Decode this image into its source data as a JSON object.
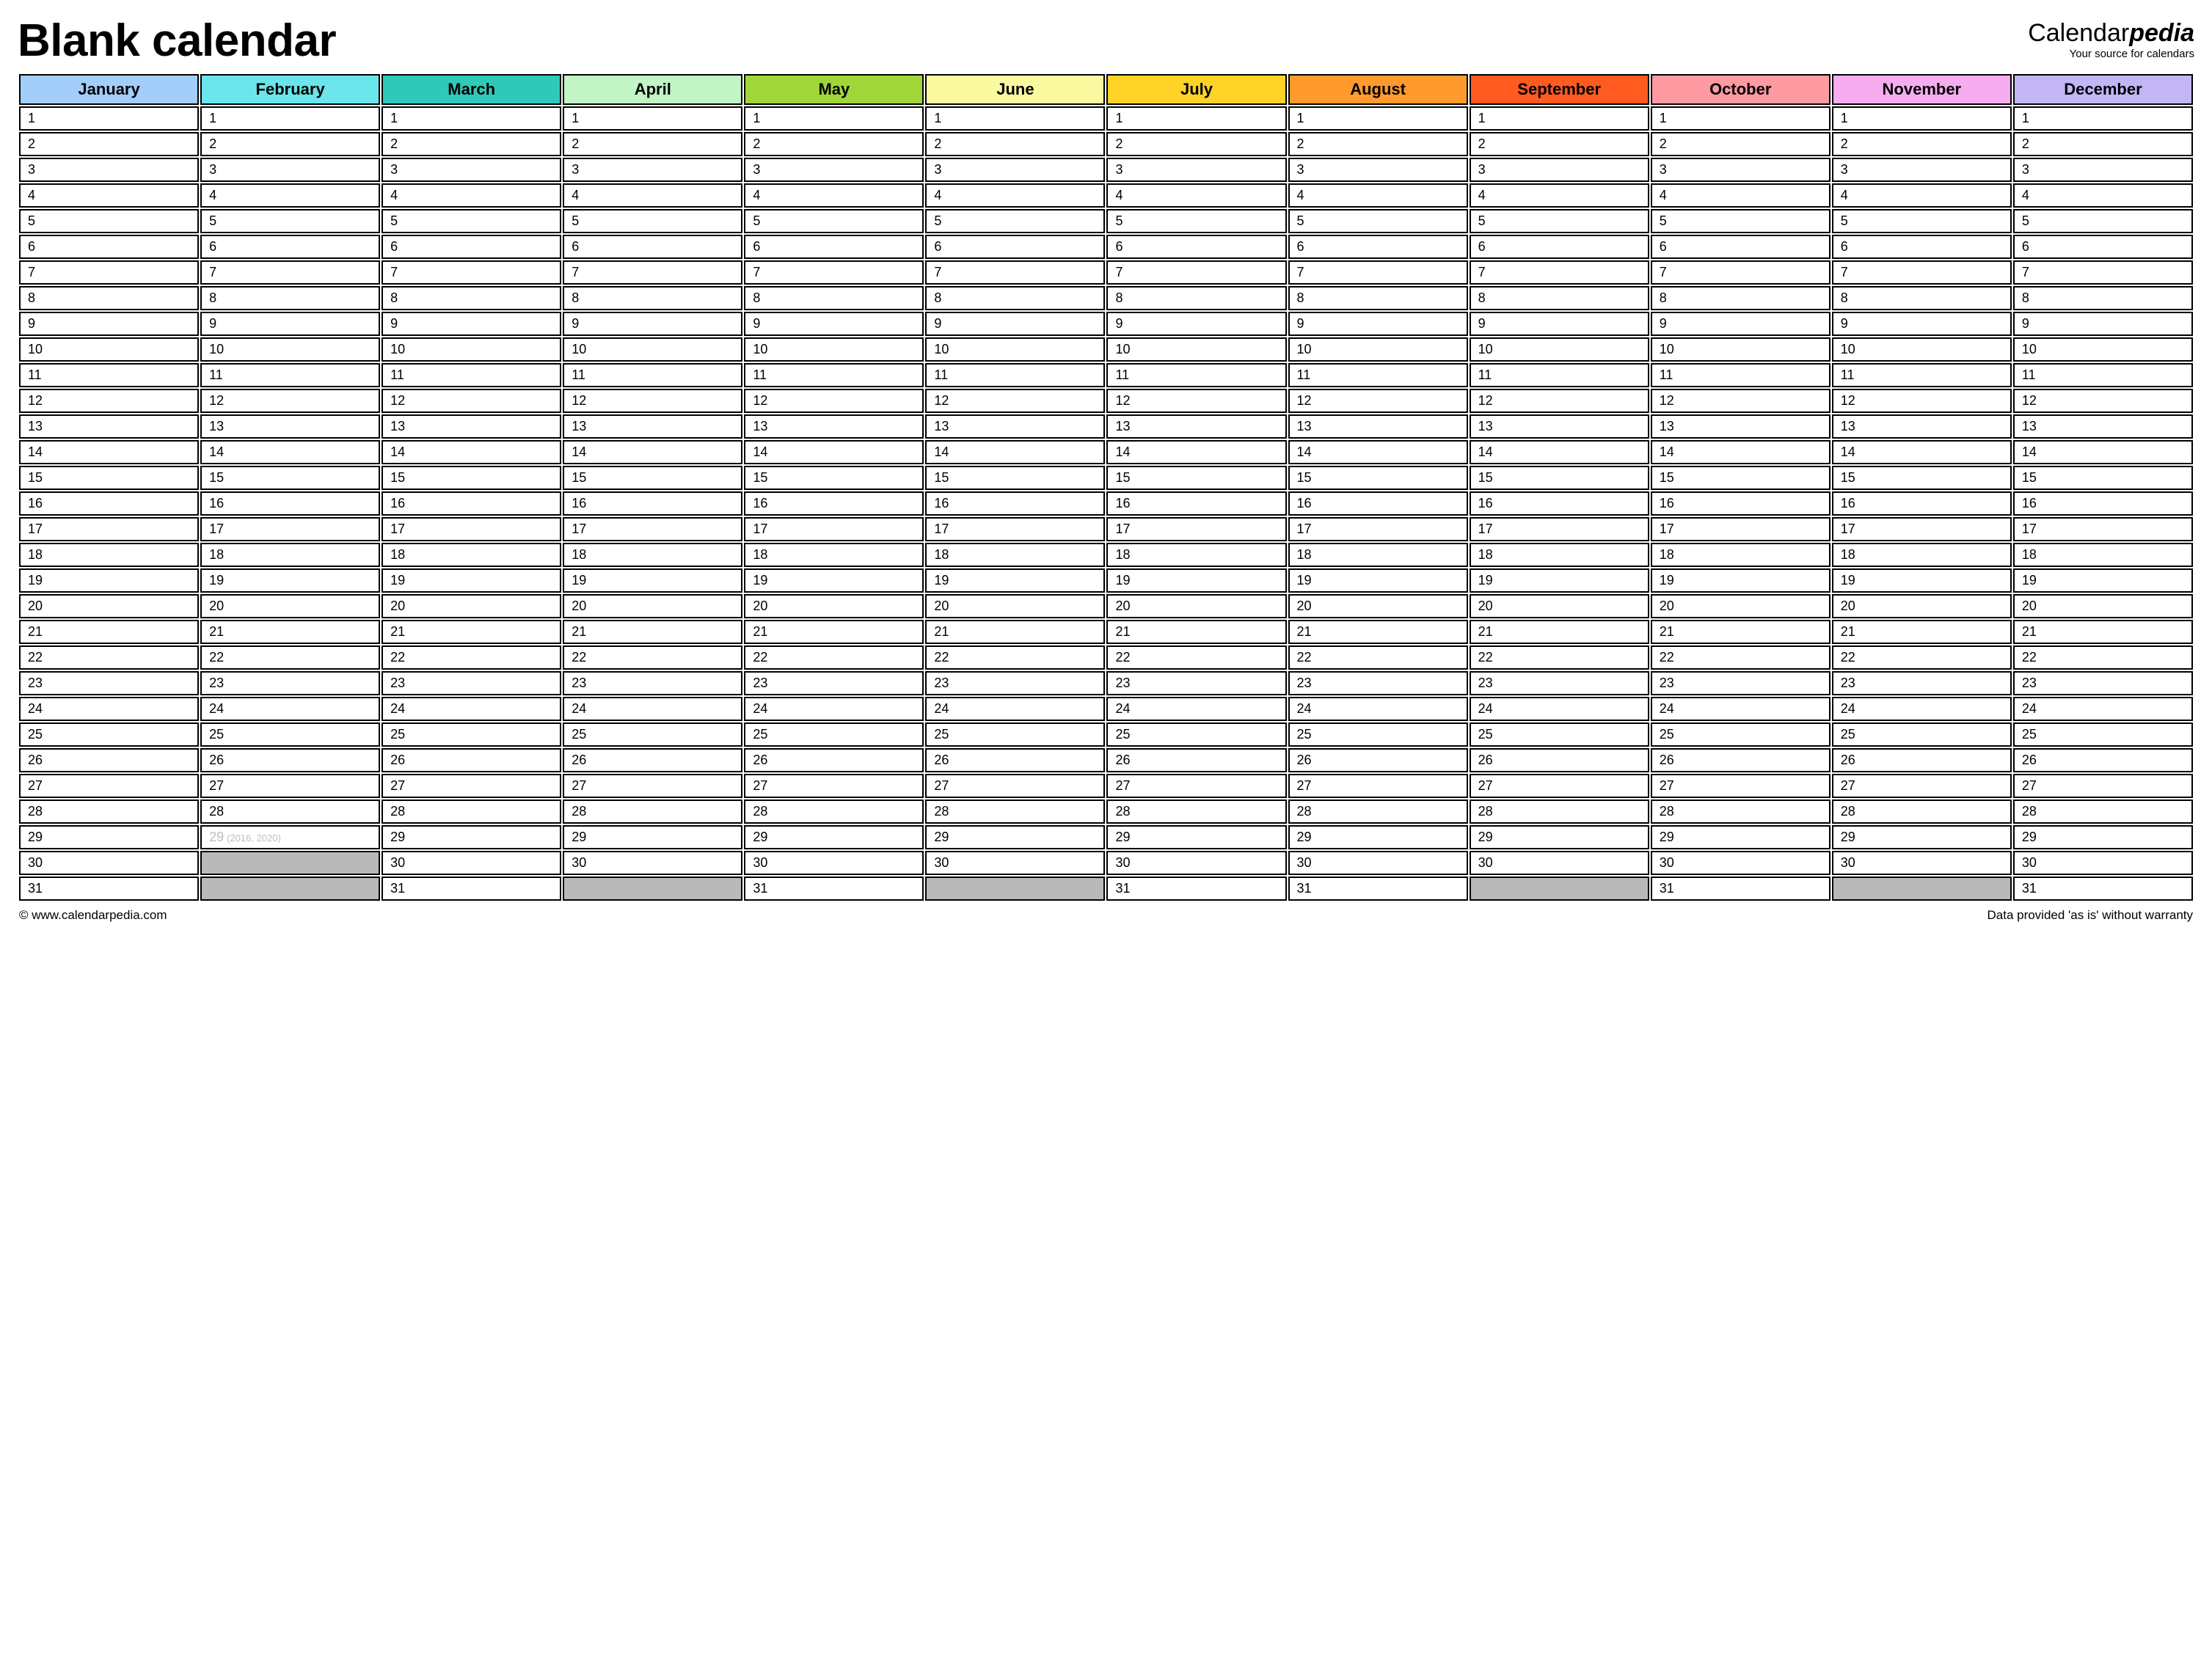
{
  "header": {
    "title": "Blank calendar",
    "brand_prefix": "Calendar",
    "brand_suffix": "pedia",
    "brand_tagline": "Your source for calendars"
  },
  "months": [
    {
      "name": "January",
      "color": "#a3cdfb",
      "days": 31
    },
    {
      "name": "February",
      "color": "#6ae5ea",
      "days": 28,
      "leap": {
        "day": "29",
        "years": "(2016, 2020)"
      }
    },
    {
      "name": "March",
      "color": "#2fc9b9",
      "days": 31
    },
    {
      "name": "April",
      "color": "#c2f4c5",
      "days": 30
    },
    {
      "name": "May",
      "color": "#a0d639",
      "days": 31
    },
    {
      "name": "June",
      "color": "#fbf9a0",
      "days": 30
    },
    {
      "name": "July",
      "color": "#ffd227",
      "days": 31
    },
    {
      "name": "August",
      "color": "#ff9a2e",
      "days": 31
    },
    {
      "name": "September",
      "color": "#ff5a1f",
      "days": 30
    },
    {
      "name": "October",
      "color": "#fd9aa2",
      "days": 31
    },
    {
      "name": "November",
      "color": "#f5adf0",
      "days": 30
    },
    {
      "name": "December",
      "color": "#c2b6f7",
      "days": 31
    }
  ],
  "max_rows": 31,
  "footer": {
    "left": "© www.calendarpedia.com",
    "right": "Data provided 'as is' without warranty"
  }
}
